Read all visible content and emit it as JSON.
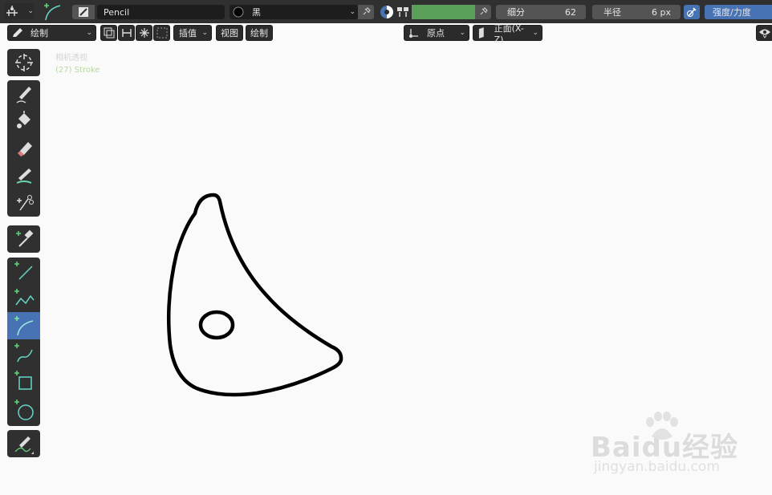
{
  "header": {
    "brush_name": "Pencil",
    "material_name": "黑",
    "subdivision_label": "细分",
    "subdivision_value": "62",
    "radius_label": "半径",
    "radius_value": "6 px",
    "strength_label": "强度/力度",
    "color_swatch": "#5aa05a"
  },
  "toolbar2": {
    "mode_label": "绘制",
    "interpolate_label": "插值",
    "view_label": "视图",
    "draw_label": "绘制",
    "origin_label": "原点",
    "plane_label": "正面(X-Z)"
  },
  "viewport": {
    "camera_text": "相机透视",
    "object_text": "(27) Stroke",
    "stroke_color": "#000000"
  },
  "tools": [
    {
      "name": "cursor",
      "icon": "cursor-icon"
    },
    {
      "name": "draw",
      "icon": "pencil-draw-icon"
    },
    {
      "name": "fill",
      "icon": "fill-bucket-icon"
    },
    {
      "name": "erase",
      "icon": "eraser-icon"
    },
    {
      "name": "tint",
      "icon": "tint-brush-icon"
    },
    {
      "name": "cutter",
      "icon": "scissors-cutter-icon"
    },
    {
      "name": "eyedropper",
      "icon": "eyedropper-icon"
    },
    {
      "name": "line",
      "icon": "line-icon"
    },
    {
      "name": "polyline",
      "icon": "polyline-icon"
    },
    {
      "name": "arc",
      "icon": "arc-icon",
      "active": true
    },
    {
      "name": "curve",
      "icon": "curve-icon"
    },
    {
      "name": "box",
      "icon": "box-icon"
    },
    {
      "name": "circle",
      "icon": "circle-icon"
    },
    {
      "name": "annotate",
      "icon": "annotate-icon"
    }
  ],
  "watermark": {
    "logo_text": "Baidu经验",
    "url_text": "jingyan.baidu.com"
  }
}
